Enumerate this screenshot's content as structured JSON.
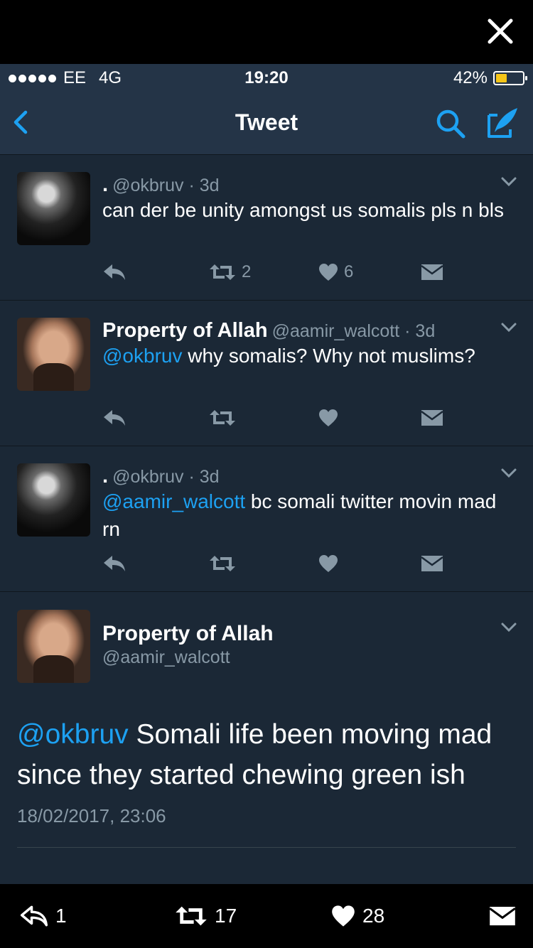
{
  "status": {
    "carrier": "EE",
    "network": "4G",
    "time": "19:20",
    "battery_pct": "42%",
    "battery_level": 0.42
  },
  "nav": {
    "title": "Tweet"
  },
  "tweets": [
    {
      "name": ".",
      "handle": "@okbruv",
      "age": "· 3d",
      "text": "can der be unity amongst us somalis pls n bls",
      "retweets": "2",
      "likes": "6"
    },
    {
      "name": "Property of Allah",
      "handle": "@aamir_walcott",
      "age": "· 3d",
      "mention": "@okbruv",
      "text": " why somalis? Why not muslims?",
      "retweets": "",
      "likes": ""
    },
    {
      "name": ".",
      "handle": "@okbruv",
      "age": "· 3d",
      "mention": "@aamir_walcott",
      "text": " bc somali twitter movin mad rn",
      "retweets": "",
      "likes": ""
    }
  ],
  "detail": {
    "name": "Property of Allah",
    "handle": "@aamir_walcott",
    "mention": "@okbruv",
    "text": " Somali life been moving mad since they started chewing green ish",
    "timestamp": "18/02/2017, 23:06"
  },
  "bottom": {
    "replies": "1",
    "retweets": "17",
    "likes": "28"
  },
  "colors": {
    "accent": "#1da1f2",
    "background": "#1b2836",
    "header": "#243447",
    "muted": "#8899a6"
  }
}
